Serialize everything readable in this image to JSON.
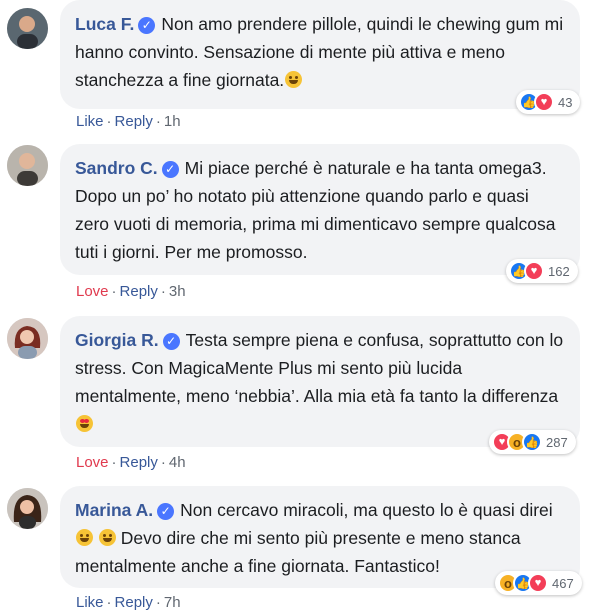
{
  "comments": [
    {
      "author": "Luca F.",
      "text": "Non amo prendere pillole, quindi le chewing gum mi hanno convinto. Sensazione di mente più attiva e meno stanchezza a fine giornata.",
      "emoji": "grinning-face",
      "reactions": [
        "like",
        "love"
      ],
      "reaction_count": "43",
      "action": "Like",
      "reply": "Reply",
      "time": "1h"
    },
    {
      "author": "Sandro C.",
      "text": "Mi piace perché è naturale e ha tanta omega3. Dopo un po’ ho notato più attenzione quando parlo e quasi zero vuoti di memoria, prima mi dimenticavo sempre qualcosa tuti i giorni. Per me promosso.",
      "reactions": [
        "like",
        "love"
      ],
      "reaction_count": "162",
      "action": "Love",
      "reply": "Reply",
      "time": "3h"
    },
    {
      "author": "Giorgia R.",
      "text": "Testa sempre piena e confusa, soprattutto con lo stress. Con MagicaMente Plus mi sento più lucida mentalmente, meno ‘nebbia’. Alla mia età fa tanto la differenza",
      "emoji": "heart-eyes-face",
      "reactions": [
        "love",
        "wow",
        "like"
      ],
      "reaction_count": "287",
      "action": "Love",
      "reply": "Reply",
      "time": "4h"
    },
    {
      "author": "Marina A.",
      "text_before": "Non cercavo miracoli, ma questo lo è quasi direi",
      "text_after": "Devo dire che mi sento più presente e meno stanca mentalmente anche a fine giornata. Fantastico!",
      "emoji": "laughing-face",
      "reactions": [
        "wow",
        "like",
        "love"
      ],
      "reaction_count": "467",
      "action": "Like",
      "reply": "Reply",
      "time": "7h"
    }
  ],
  "colors": {
    "author": "#385898",
    "bubble": "#f2f3f5",
    "like": "#1877f2",
    "love": "#f33e58",
    "love_text": "#e03a4e"
  }
}
